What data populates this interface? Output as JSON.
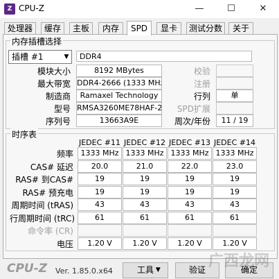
{
  "window": {
    "title": "CPU-Z",
    "minimize": "—",
    "maximize": "☐",
    "close": "✕"
  },
  "tabs": [
    "处理器",
    "缓存",
    "主板",
    "内存",
    "SPD",
    "显卡",
    "测试分数",
    "关于"
  ],
  "active_tab": "SPD",
  "slot_section": {
    "title": "内存插槽选择",
    "slot_select": "插槽 #1",
    "type": "DDR4",
    "module_size_label": "模块大小",
    "module_size": "8192 MBytes",
    "max_bandwidth_label": "最大带宽",
    "max_bandwidth": "DDR4-2666 (1333 MHz)",
    "manufacturer_label": "制造商",
    "manufacturer": "Ramaxel Technology",
    "part_number_label": "型号",
    "part_number": "RMSA3260ME78HAF-26",
    "serial_label": "序列号",
    "serial": "13663A9E",
    "correction_label": "校验",
    "registered_label": "注册",
    "ranks_label": "行列",
    "ranks": "单",
    "spd_ext_label": "SPD扩展",
    "week_year_label": "周次/年份",
    "week_year": "11 / 19"
  },
  "timings": {
    "title": "时序表",
    "columns": [
      "JEDEC #11",
      "JEDEC #12",
      "JEDEC #13",
      "JEDEC #14"
    ],
    "rows": [
      {
        "label": "频率",
        "values": [
          "1333 MHz",
          "1333 MHz",
          "1333 MHz",
          "1333 MHz"
        ],
        "dim": false
      },
      {
        "label": "CAS# 延迟",
        "values": [
          "20.0",
          "21.0",
          "22.0",
          "23.0"
        ],
        "dim": false
      },
      {
        "label": "RAS# 到CAS#",
        "values": [
          "19",
          "19",
          "19",
          "19"
        ],
        "dim": false
      },
      {
        "label": "RAS# 预充电",
        "values": [
          "19",
          "19",
          "19",
          "19"
        ],
        "dim": false
      },
      {
        "label": "周期时间 (tRAS)",
        "values": [
          "43",
          "43",
          "43",
          "43"
        ],
        "dim": false
      },
      {
        "label": "行周期时间 (tRC)",
        "values": [
          "61",
          "61",
          "61",
          "61"
        ],
        "dim": false
      },
      {
        "label": "命令率 (CR)",
        "values": [
          "",
          "",
          "",
          ""
        ],
        "dim": true
      },
      {
        "label": "电压",
        "values": [
          "1.20 V",
          "1.20 V",
          "1.20 V",
          "1.20 V"
        ],
        "dim": false
      }
    ]
  },
  "footer": {
    "logo": "CPU-Z",
    "version": "Ver. 1.85.0.x64",
    "tools_button": "工具",
    "validate_button": "验证",
    "ok_button": "确定",
    "watermark": "广西龙网"
  }
}
